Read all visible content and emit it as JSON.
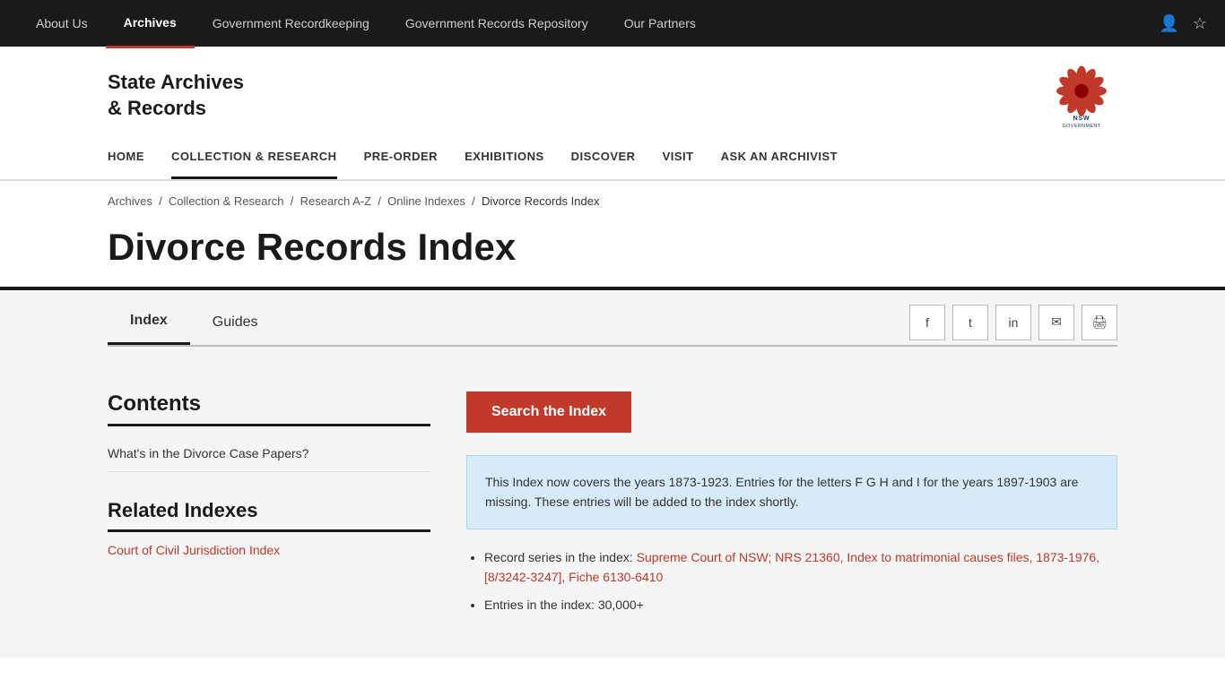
{
  "topNav": {
    "links": [
      {
        "id": "about-us",
        "label": "About Us",
        "active": false
      },
      {
        "id": "archives",
        "label": "Archives",
        "active": true
      },
      {
        "id": "gov-recordkeeping",
        "label": "Government Recordkeeping",
        "active": false
      },
      {
        "id": "gov-records-repo",
        "label": "Government Records Repository",
        "active": false
      },
      {
        "id": "our-partners",
        "label": "Our Partners",
        "active": false
      }
    ],
    "icons": {
      "user": "👤",
      "star": "☆"
    }
  },
  "logo": {
    "line1": "State Archives",
    "line2": "& Records"
  },
  "mainNav": {
    "links": [
      {
        "id": "home",
        "label": "HOME",
        "active": false
      },
      {
        "id": "collection-research",
        "label": "COLLECTION & RESEARCH",
        "active": true
      },
      {
        "id": "pre-order",
        "label": "PRE-ORDER",
        "active": false
      },
      {
        "id": "exhibitions",
        "label": "EXHIBITIONS",
        "active": false
      },
      {
        "id": "discover",
        "label": "DISCOVER",
        "active": false
      },
      {
        "id": "visit",
        "label": "VISIT",
        "active": false
      },
      {
        "id": "ask-archivist",
        "label": "ASK AN ARCHIVIST",
        "active": false
      }
    ]
  },
  "breadcrumb": {
    "items": [
      {
        "label": "Archives",
        "link": true
      },
      {
        "label": "Collection & Research",
        "link": true
      },
      {
        "label": "Research A-Z",
        "link": true
      },
      {
        "label": "Online Indexes",
        "link": true
      },
      {
        "label": "Divorce Records Index",
        "link": false
      }
    ],
    "separator": "/"
  },
  "pageTitle": "Divorce Records Index",
  "tabs": [
    {
      "id": "index",
      "label": "Index",
      "active": true
    },
    {
      "id": "guides",
      "label": "Guides",
      "active": false
    }
  ],
  "shareIcons": [
    {
      "id": "facebook",
      "symbol": "f"
    },
    {
      "id": "twitter",
      "symbol": "t"
    },
    {
      "id": "linkedin",
      "symbol": "in"
    },
    {
      "id": "email",
      "symbol": "✉"
    },
    {
      "id": "print",
      "symbol": "🖨"
    }
  ],
  "leftCol": {
    "contentsTitle": "Contents",
    "contentsLinks": [
      {
        "id": "whats-in-divorce",
        "label": "What's in the Divorce Case Papers?"
      }
    ],
    "relatedTitle": "Related Indexes",
    "relatedLinks": [
      {
        "id": "court-civil",
        "label": "Court of Civil Jurisdiction Index"
      }
    ]
  },
  "rightCol": {
    "searchButtonLabel": "Search the Index",
    "infoBox": "This Index now covers the years 1873-1923. Entries for the letters F G H and I for the years 1897-1903 are missing. These entries will be added to the index shortly.",
    "recordListLabel": "Record series in the index:",
    "recordLinks": [
      {
        "id": "supreme-court-link",
        "label": "Supreme Court of NSW; NRS 21360, Index to matrimonial causes files, 1873-1976, [8/3242-3247], Fiche 6130-6410"
      }
    ],
    "entriesLabel": "Entries in the index: 30,000+"
  }
}
